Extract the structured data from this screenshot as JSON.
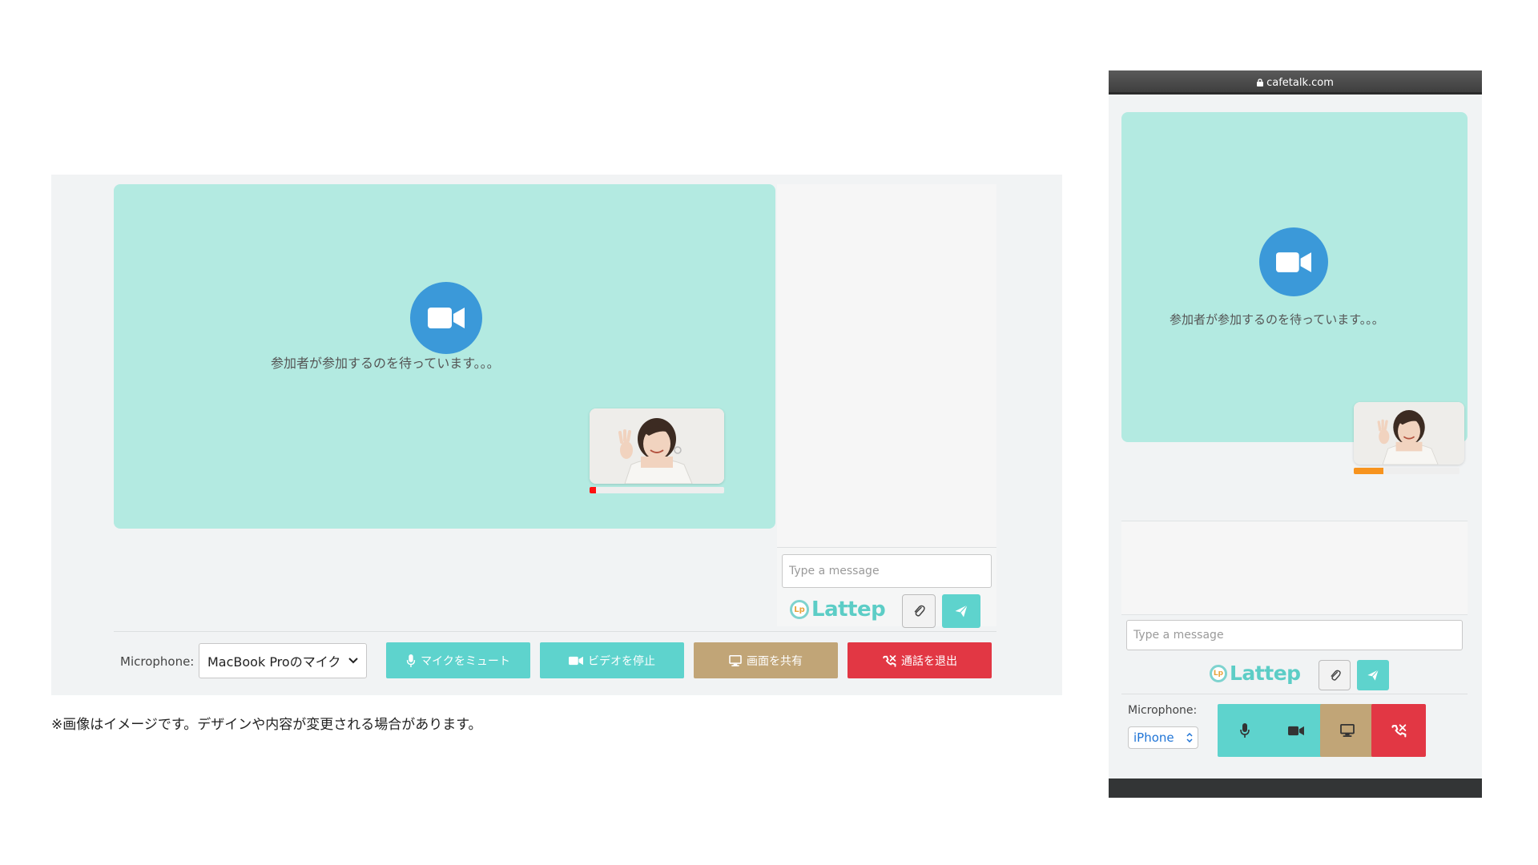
{
  "desktop": {
    "waiting_text": "参加者が参加するのを待っています。。。",
    "self_level": 0.05,
    "chat": {
      "placeholder": "Type a message",
      "logo_mark": "Lp",
      "logo_text": "Lattep"
    },
    "controls": {
      "mic_label": "Microphone:",
      "mic_value": "MacBook Proのマイク",
      "mute_label": "マイクをミュート",
      "video_label": "ビデオを停止",
      "share_label": "画面を共有",
      "leave_label": "通話を退出"
    }
  },
  "caption": "※画像はイメージです。デザインや内容が変更される場合があります。",
  "mobile": {
    "url": "cafetalk.com",
    "waiting_text": "参加者が参加するのを待っています。。。",
    "self_level": 0.28,
    "chat": {
      "placeholder": "Type a message",
      "logo_mark": "Lp",
      "logo_text": "Lattep"
    },
    "controls": {
      "mic_label": "Microphone:",
      "mic_value": "iPhone"
    }
  },
  "colors": {
    "video_bg": "#b3eae1",
    "camera_circle": "#3b99d9",
    "teal_button": "#5ed3cd",
    "tan_button": "#c1a577",
    "red_button": "#e23744",
    "level_desktop": "#ff1111",
    "level_mobile": "#f7931e"
  },
  "icons": [
    "video-camera-icon",
    "microphone-icon",
    "screen-icon",
    "hangup-icon",
    "paperclip-icon",
    "send-icon",
    "lock-icon",
    "chevron-down-icon"
  ]
}
